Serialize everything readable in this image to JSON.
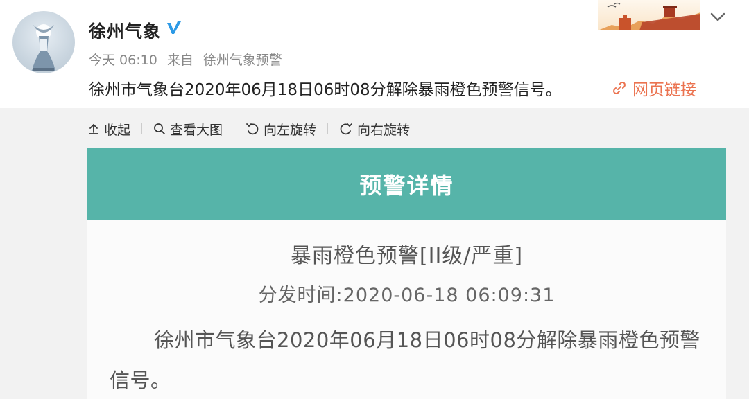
{
  "post": {
    "username": "徐州气象",
    "time": "今天 06:10",
    "source_prefix": "来自",
    "source": "徐州气象预警",
    "text": "徐州市气象台2020年06月18日06时08分解除暴雨橙色预警信号。",
    "link_label": "网页链接"
  },
  "toolbar": {
    "collapse": "收起",
    "view_large": "查看大图",
    "rotate_left": "向左旋转",
    "rotate_right": "向右旋转"
  },
  "alert_image": {
    "banner_title": "预警详情",
    "level": "暴雨橙色预警[II级/严重]",
    "issue_time": "分发时间:2020-06-18 06:09:31",
    "body": "徐州市气象台2020年06月18日06时08分解除暴雨橙色预警信号。"
  },
  "colors": {
    "accent_link": "#eb7350",
    "verified_blue": "#2d9ae6",
    "banner_teal": "#56b4a9"
  },
  "icons": {
    "verified": "verified-icon",
    "link": "link-icon",
    "collapse": "arrow-up-icon",
    "view_large": "search-icon",
    "rotate_left": "rotate-left-icon",
    "rotate_right": "rotate-right-icon",
    "menu": "chevron-down-icon"
  }
}
